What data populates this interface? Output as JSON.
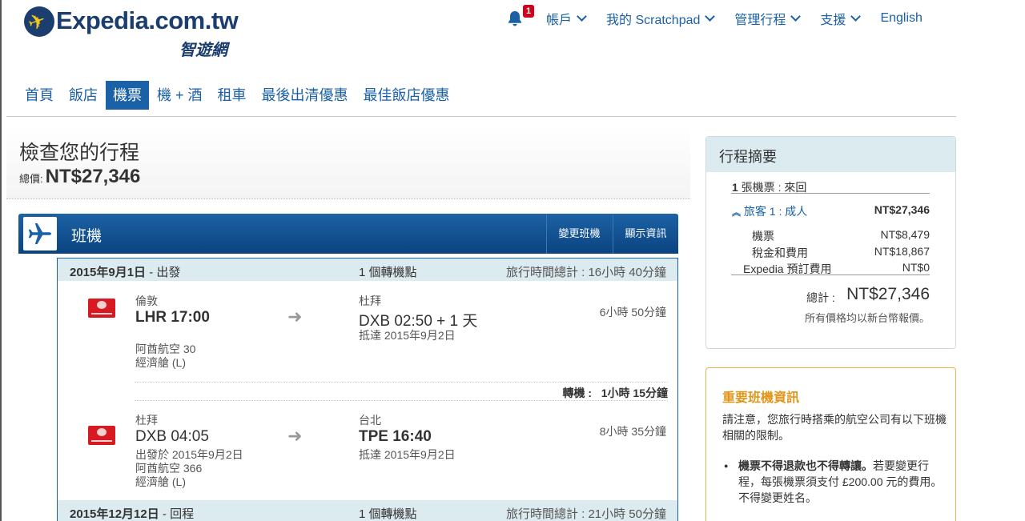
{
  "brand": {
    "name": "Expedia.com.tw",
    "sub": "智遊網"
  },
  "topnav": {
    "notification_count": "1",
    "account": "帳戶",
    "scratchpad": "我的 Scratchpad",
    "manage": "管理行程",
    "support": "支援",
    "language": "English"
  },
  "mainnav": {
    "tabs": [
      {
        "label": "首頁"
      },
      {
        "label": "飯店"
      },
      {
        "label": "機票"
      },
      {
        "label": "機 + 酒"
      },
      {
        "label": "租車"
      },
      {
        "label": "最後出清優惠"
      },
      {
        "label": "最佳飯店優惠"
      }
    ],
    "active": "機票"
  },
  "review": {
    "title": "檢查您的行程",
    "total_label": "總價:",
    "total": "NT$27,346"
  },
  "flight_panel": {
    "title": "班機",
    "change_label": "變更班機",
    "details_label": "顯示資訊"
  },
  "outbound": {
    "date": "2015年9月1日",
    "direction": "- 出發",
    "stops": "1 個轉機點",
    "total_duration": "旅行時間總計 : 16小時 40分鐘",
    "leg1": {
      "from_city": "倫敦",
      "from_code": "LHR 17:00",
      "to_city": "杜拜",
      "to_code": "DXB 02:50 + 1 天",
      "arrive": "抵達 2015年9月2日",
      "flight": "阿酋航空 30",
      "cabin": "經濟艙 (L)",
      "duration": "6小時 50分鐘"
    },
    "layover_label": "轉機 :",
    "layover_time": "1小時 15分鐘",
    "leg2": {
      "from_city": "杜拜",
      "from_code": "DXB 04:05",
      "depart": "出發於 2015年9月2日",
      "flight": "阿酋航空 366",
      "cabin": "經濟艙 (L)",
      "to_city": "台北",
      "to_code": "TPE 16:40",
      "arrive": "抵達 2015年9月2日",
      "duration": "8小時 35分鐘"
    }
  },
  "return": {
    "date": "2015年12月12日",
    "direction": "- 回程",
    "stops": "1 個轉機點",
    "total_duration": "旅行時間總計 : 21小時 50分鐘"
  },
  "summary": {
    "title": "行程摘要",
    "tickets_count": "1",
    "tickets_label": "張機票 :",
    "trip_type": "來回",
    "traveler_label": "旅客 1 :",
    "traveler_type": "成人",
    "traveler_total": "NT$27,346",
    "fare_label": "機票",
    "fare": "NT$8,479",
    "tax_label": "稅金和費用",
    "tax": "NT$18,867",
    "fee_label": "Expedia 預訂費用",
    "fee": "NT$0",
    "total_label": "總計 :",
    "total": "NT$27,346",
    "note": "所有價格均以新台幣報價。"
  },
  "important": {
    "title": "重要班機資訊",
    "body": "請注意，您旅行時搭乘的航空公司有以下班機相關的限制。",
    "bullet_bold": "機票不得退款也不得轉讓。",
    "bullet_rest": "若要變更行程，每張機票須支付 £200.00 元的費用。不得變更姓名。"
  },
  "colors": {
    "link": "#1a61a8",
    "bar_dark": "#0b4380",
    "segment_bg": "#dcebf0",
    "warning": "#e0961a",
    "airline_red": "#d71a21",
    "badge_red": "#d0021b"
  }
}
